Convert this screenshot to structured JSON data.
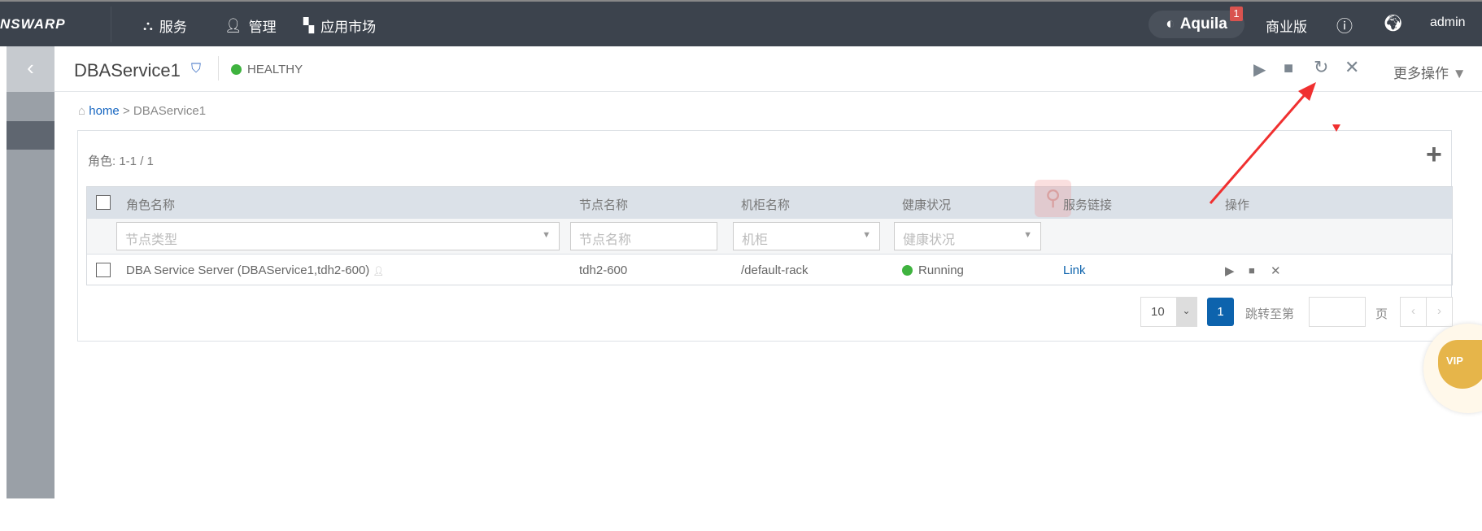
{
  "topbar": {
    "logo": "NSWARP",
    "nav": [
      {
        "label": "服务",
        "icon": "services-icon"
      },
      {
        "label": "管理",
        "icon": "user-icon"
      },
      {
        "label": "应用市场",
        "icon": "apps-icon"
      }
    ],
    "aquila": "Aquila",
    "aquila_badge": "1",
    "edition": "商业版",
    "user": "admin"
  },
  "header": {
    "title": "DBAService1",
    "status": "HEALTHY",
    "status_color": "#3fb33f",
    "more_actions": "更多操作"
  },
  "breadcrumb": {
    "home": "home",
    "sep": ">",
    "current": "DBAService1"
  },
  "roles": {
    "count_label": "角色:",
    "count": "1-1 / 1",
    "columns": [
      "角色名称",
      "节点名称",
      "机柜名称",
      "健康状况",
      "服务链接",
      "操作"
    ],
    "filters": {
      "type": "节点类型",
      "node": "节点名称",
      "rack": "机柜",
      "health": "健康状况"
    },
    "rows": [
      {
        "name": "DBA Service Server (DBAService1,tdh2-600)",
        "node": "tdh2-600",
        "rack": "/default-rack",
        "health": "Running",
        "link": "Link"
      }
    ]
  },
  "pagination": {
    "page_size": "10",
    "current": "1",
    "jump_label": "跳转至第",
    "page_suffix": "页"
  },
  "vip": "VIP",
  "accent": "#0d63ad"
}
